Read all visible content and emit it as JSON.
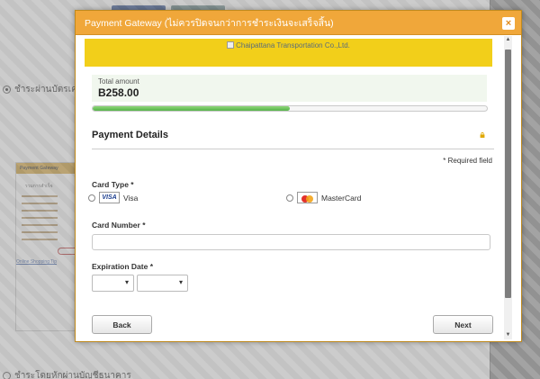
{
  "background": {
    "option_credit_card": "ชำระผ่านบัตรเครดิต",
    "option_bank_account": "ชำระโดยหักผ่านบัญชีธนาคาร",
    "thumb_header": "Payment Gateway",
    "thumb_summary": "รวมการสำเร็จ",
    "thumb_link": "Online Shopping Tip"
  },
  "modal": {
    "title": "Payment Gateway (ไม่ควรปิดจนกว่าการชำระเงินจะเสร็จสิ้น)",
    "close_label": "×",
    "merchant_logo_alt": "Chaipattana Transportation Co.,Ltd.",
    "total_label": "Total amount",
    "total_value": "B258.00",
    "progress": 0.5,
    "section_title": "Payment Details",
    "required_note": "* Required field",
    "card_type": {
      "label": "Card Type *",
      "options": [
        {
          "label": "Visa",
          "logo_text": "VISA"
        },
        {
          "label": "MasterCard"
        }
      ]
    },
    "card_number": {
      "label": "Card Number *",
      "value": ""
    },
    "expiration": {
      "label": "Expiration Date *",
      "month": "",
      "year": ""
    },
    "buttons": {
      "back": "Back",
      "next": "Next"
    }
  },
  "colors": {
    "header": "#f0a73a",
    "logo_bar": "#f2cf1a",
    "progress_fill": "#55b348"
  }
}
